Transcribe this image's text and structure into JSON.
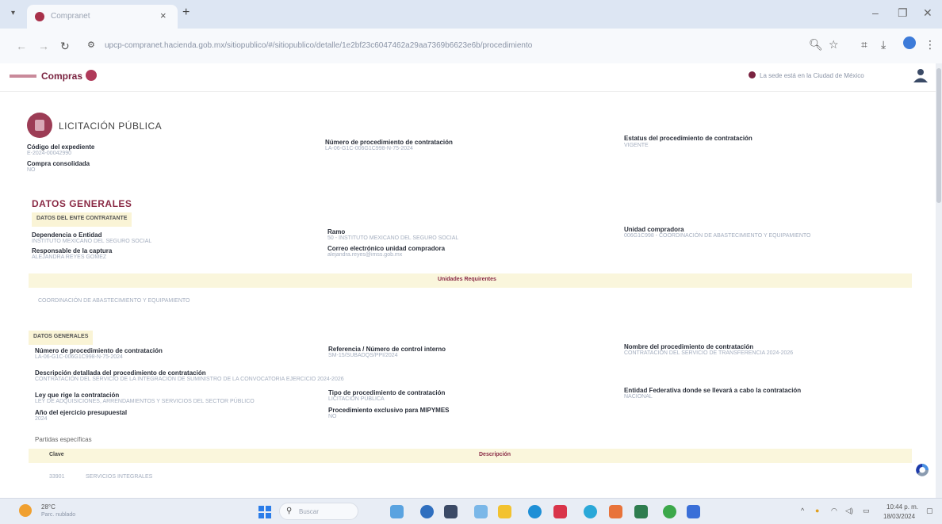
{
  "browser": {
    "tab_title": "Compranet",
    "url": "upcp-compranet.hacienda.gob.mx/sitiopublico/#/sitiopublico/detalle/1e2bf23c6047462a29aa7369b6623e6b/procedimiento",
    "window_minimize": "–",
    "window_restore": "❐",
    "window_close": "✕"
  },
  "site": {
    "logo_text": "Compras",
    "location_text": "La sede está en la Ciudad de México"
  },
  "procedure": {
    "type_title": "LICITACIÓN PÚBLICA",
    "fields": {
      "expediente_label": "Código del expediente",
      "expediente_value": "E-2024-00042990",
      "compra_label": "Compra consolidada",
      "compra_value": "NO",
      "numero_label": "Número de procedimiento de contratación",
      "numero_value": "LA-06-G1C-006G1C998-N-75-2024",
      "estatus_label": "Estatus del procedimiento de contratación",
      "estatus_value": "VIGENTE"
    }
  },
  "datos_generales_title": "DATOS GENERALES",
  "ente": {
    "header": "DATOS DEL ENTE CONTRATANTE",
    "dependencia_label": "Dependencia o Entidad",
    "dependencia_value": "INSTITUTO MEXICANO DEL SEGURO SOCIAL",
    "ramo_label": "Ramo",
    "ramo_value": "50 - INSTITUTO MEXICANO DEL SEGURO SOCIAL",
    "unidad_label": "Unidad compradora",
    "unidad_value": "006G1C998 - COORDINACIÓN DE ABASTECIMIENTO Y EQUIPAMIENTO",
    "responsable_label": "Responsable de la captura",
    "responsable_value": "ALEJANDRA REYES GOMEZ",
    "correo_label": "Correo electrónico unidad compradora",
    "correo_value": "alejandra.reyes@imss.gob.mx",
    "requirentes_title": "Unidades Requirentes",
    "requirentes_value": "COORDINACIÓN DE ABASTECIMIENTO Y EQUIPAMIENTO"
  },
  "generales": {
    "header": "DATOS GENERALES",
    "numero_label": "Número de procedimiento de contratación",
    "numero_value": "LA-06-G1C-006G1C998-N-75-2024",
    "referencia_label": "Referencia / Número de control interno",
    "referencia_value": "SM-15/SUBADQS/PPI/2024",
    "nombre_label": "Nombre del procedimiento de contratación",
    "nombre_value": "CONTRATACIÓN DEL SERVICIO DE TRANSFERENCIA 2024-2026",
    "descripcion_label": "Descripción detallada del procedimiento de contratación",
    "descripcion_value": "CONTRATACIÓN DEL SERVICIO DE LA INTEGRACIÓN DE SUMINISTRO DE LA CONVOCATORIA EJERCICIO 2024-2026",
    "ley_label": "Ley que rige la contratación",
    "ley_value": "LEY DE ADQUISICIONES, ARRENDAMIENTOS Y SERVICIOS DEL SECTOR PÚBLICO",
    "tipo_label": "Tipo de procedimiento de contratación",
    "tipo_value": "LICITACIÓN PÚBLICA",
    "entidad_label": "Entidad Federativa donde se llevará a cabo la contratación",
    "entidad_value": "NACIONAL",
    "anio_label": "Año del ejercicio presupuestal",
    "anio_value": "2024",
    "mipymes_label": "Procedimiento exclusivo para MIPYMES",
    "mipymes_value": "NO",
    "partidas_label": "Partidas específicas",
    "clave_header": "Clave",
    "descripcion_header": "Descripción",
    "row_clave": "33901",
    "row_desc": "SERVICIOS INTEGRALES"
  },
  "taskbar": {
    "temp": "28°C",
    "weather": "Parc. nublado",
    "search_placeholder": "Buscar",
    "time": "10:44 p. m.",
    "date": "18/03/2024"
  },
  "colors": {
    "brand": "#7a2340",
    "section_bg": "#faf6dc"
  }
}
